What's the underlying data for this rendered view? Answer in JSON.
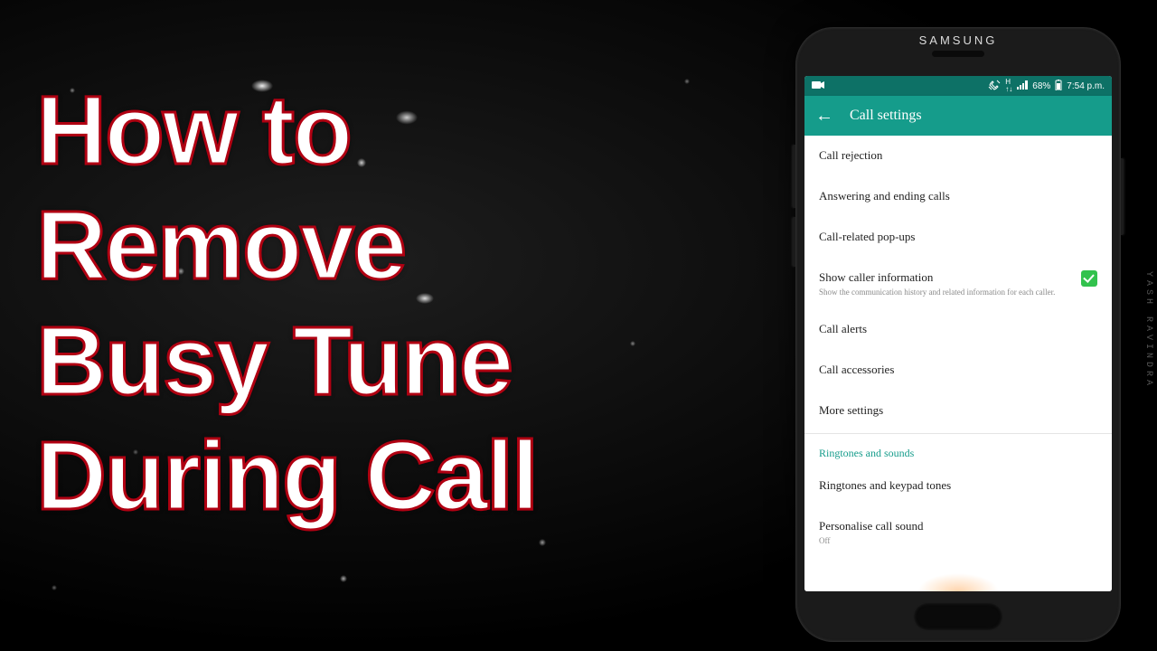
{
  "overlay_title_lines": [
    "How to",
    "Remove",
    "Busy Tune",
    "During Call"
  ],
  "watermark": "YASH  RAVINDRA",
  "phone": {
    "brand": "SAMSUNG",
    "status": {
      "battery_pct": "68%",
      "time": "7:54 p.m.",
      "network_label": "H",
      "signal_icon": "signal",
      "mute_icon": "vibrate",
      "battery_icon": "battery-charging",
      "rec_icon": "rec"
    },
    "app_bar": {
      "title": "Call settings"
    },
    "list": {
      "items": [
        {
          "title": "Call rejection"
        },
        {
          "title": "Answering and ending calls"
        },
        {
          "title": "Call-related pop-ups"
        },
        {
          "title": "Show caller information",
          "sub": "Show the communication history and related information for each caller.",
          "checked": true
        },
        {
          "title": "Call alerts"
        },
        {
          "title": "Call accessories"
        },
        {
          "title": "More settings"
        }
      ],
      "section_header": "Ringtones and sounds",
      "items2": [
        {
          "title": "Ringtones and keypad tones"
        },
        {
          "title": "Personalise call sound",
          "sub": "Off"
        }
      ]
    }
  }
}
